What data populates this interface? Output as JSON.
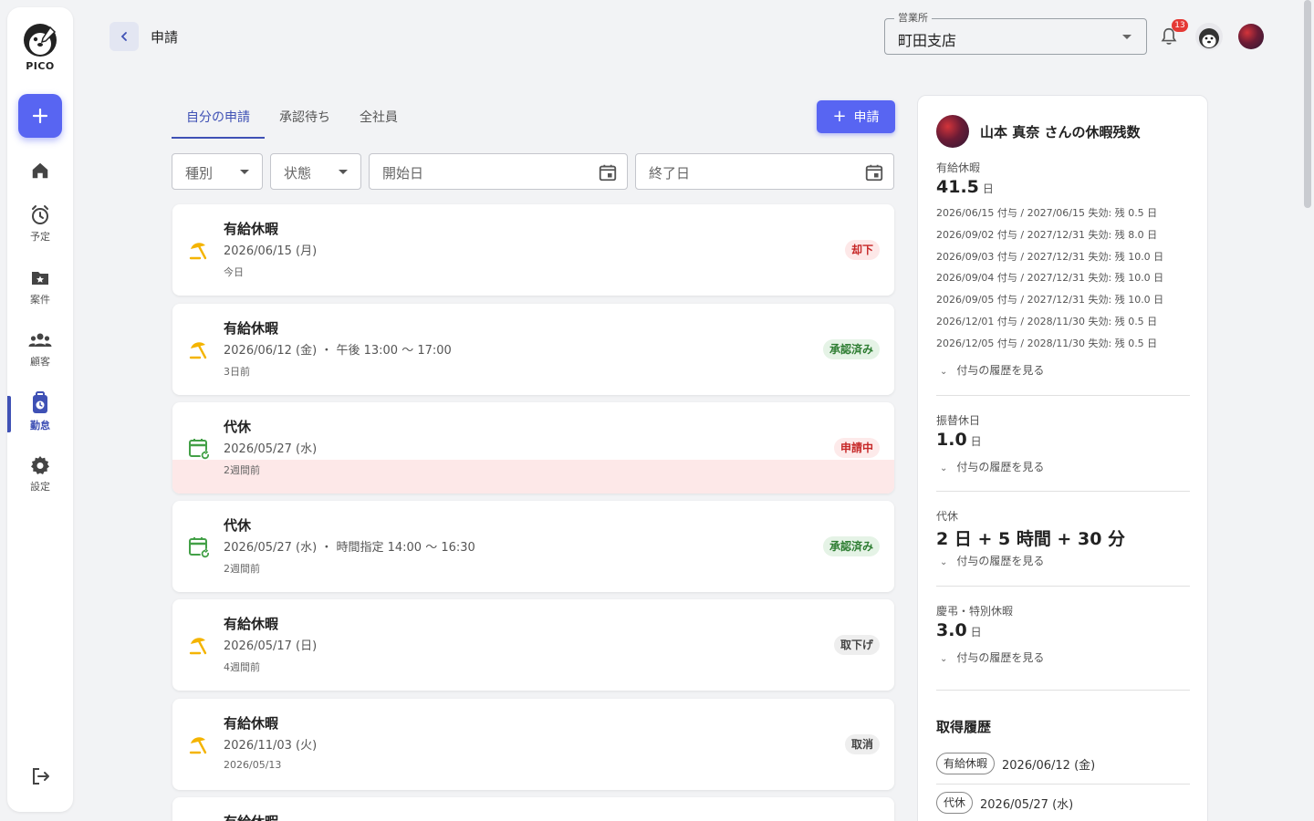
{
  "app": {
    "name": "PICO"
  },
  "sidebar": {
    "items": [
      {
        "label": ""
      },
      {
        "label": "予定"
      },
      {
        "label": "案件"
      },
      {
        "label": "顧客"
      },
      {
        "label": "勤怠"
      },
      {
        "label": "設定"
      }
    ],
    "active": "勤怠"
  },
  "header": {
    "title": "申請",
    "office": {
      "legend": "営業所",
      "value": "町田支店"
    },
    "notifications_count": "13"
  },
  "tabs": [
    {
      "label": "自分の申請",
      "active": true
    },
    {
      "label": "承認待ち",
      "active": false
    },
    {
      "label": "全社員",
      "active": false
    }
  ],
  "apply_button": {
    "label": "申請"
  },
  "filters": {
    "type": "種別",
    "status": "状態",
    "start": "開始日",
    "end": "終了日"
  },
  "requests": [
    {
      "title": "有給休暇",
      "date": "2026/06/15 (月)",
      "relative": "今日",
      "status": "却下",
      "kind": "paid"
    },
    {
      "title": "有給休暇",
      "date": "2026/06/12 (金) ・ 午後 13:00 〜 17:00",
      "relative": "3日前",
      "status": "承認済み",
      "kind": "paid"
    },
    {
      "title": "代休",
      "date": "2026/05/27 (水)",
      "relative": "2週間前",
      "status": "申請中",
      "kind": "comp"
    },
    {
      "title": "代休",
      "date": "2026/05/27 (水) ・ 時間指定 14:00 〜 16:30",
      "relative": "2週間前",
      "status": "承認済み",
      "kind": "comp"
    },
    {
      "title": "有給休暇",
      "date": "2026/05/17 (日)",
      "relative": "4週間前",
      "status": "取下げ",
      "kind": "paid"
    },
    {
      "title": "有給休暇",
      "date": "2026/11/03 (火)",
      "relative": "2026/05/13",
      "status": "取消",
      "kind": "paid"
    },
    {
      "title": "有給休暇",
      "date": "",
      "relative": "",
      "status": "",
      "kind": "paid"
    }
  ],
  "balance": {
    "title": "山本 真奈 さんの休暇残数",
    "paid": {
      "label": "有給休暇",
      "value": "41.5",
      "unit": "日",
      "grants": [
        "2026/06/15 付与 / 2027/06/15 失効: 残 0.5 日",
        "2026/09/02 付与 / 2027/12/31 失効: 残 8.0 日",
        "2026/09/03 付与 / 2027/12/31 失効: 残 10.0 日",
        "2026/09/04 付与 / 2027/12/31 失効: 残 10.0 日",
        "2026/09/05 付与 / 2027/12/31 失効: 残 10.0 日",
        "2026/12/01 付与 / 2028/11/30 失効: 残 0.5 日",
        "2026/12/05 付与 / 2028/11/30 失効: 残 0.5 日"
      ]
    },
    "substitute": {
      "label": "振替休日",
      "value": "1.0",
      "unit": "日"
    },
    "comp": {
      "label": "代休",
      "value": "2 日 + 5 時間 + 30 分"
    },
    "special": {
      "label": "慶弔・特別休暇",
      "value": "3.0",
      "unit": "日"
    },
    "history_link": "付与の履歴を見る"
  },
  "acquisition": {
    "title": "取得履歴",
    "rows": [
      {
        "type": "有給休暇",
        "date": "2026/06/12 (金)"
      },
      {
        "type": "代休",
        "date": "2026/05/27 (水)"
      }
    ]
  },
  "colors": {
    "accent": "#5865f2",
    "primary": "#3f51b5",
    "paid_icon": "#f4b400",
    "comp_icon": "#43a047",
    "rejected": "#c62828",
    "approved": "#2e7d32"
  }
}
